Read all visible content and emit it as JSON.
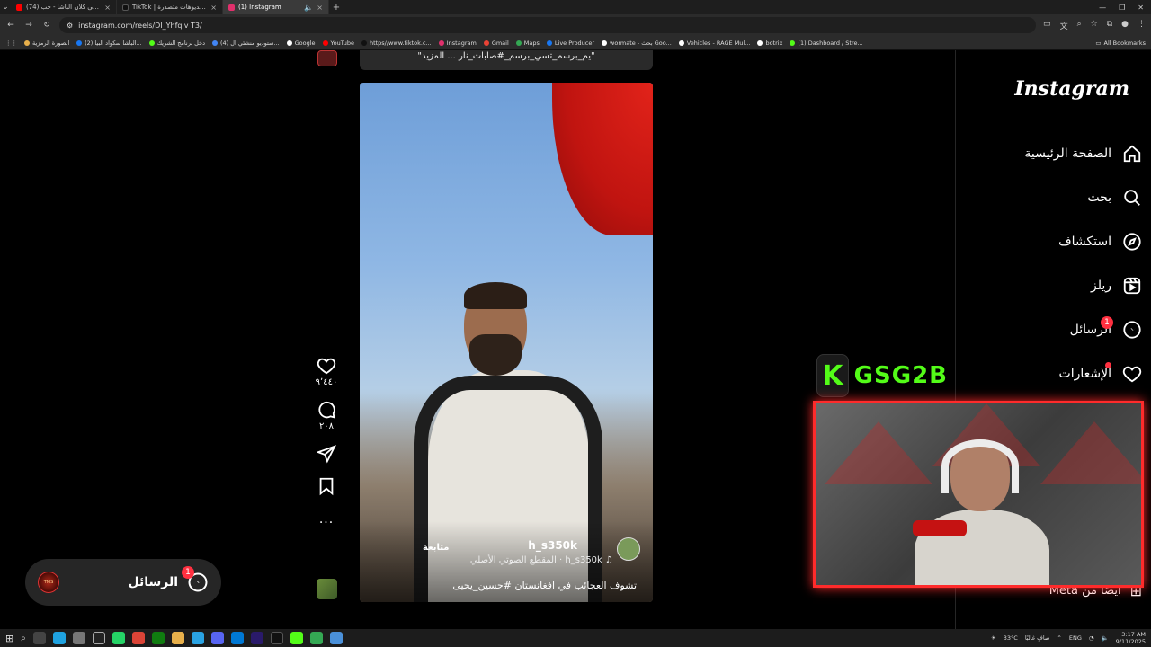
{
  "browser": {
    "tabs": [
      {
        "label": "(74) تقديم على كلان الباشا - جب",
        "active": false,
        "favicon_color": "#ff0000"
      },
      {
        "label": "TikTok | شاهد فيديوهات متصدرة",
        "active": false,
        "favicon_color": "#111111"
      },
      {
        "label": "(1) Instagram",
        "active": true,
        "favicon_color": "#e1306c"
      }
    ],
    "new_tab": "+",
    "url": "instagram.com/reels/DI_Yhfqiv T3/",
    "bookmarks": [
      {
        "label": "الصورة الرمزية",
        "color": "#e8b04b"
      },
      {
        "label": "(2) الباشا سكواد البيا...",
        "color": "#1877f2"
      },
      {
        "label": "دخل برنامج الشريك",
        "color": "#53fc18"
      },
      {
        "label": "(4) ستوديو منشئي ال...",
        "color": "#4285f4"
      },
      {
        "label": "Google",
        "color": "#ffffff"
      },
      {
        "label": "YouTube",
        "color": "#ff0000"
      },
      {
        "label": "https//www.tiktok.c...",
        "color": "#111111"
      },
      {
        "label": "Instagram",
        "color": "#e1306c"
      },
      {
        "label": "Gmail",
        "color": "#ea4335"
      },
      {
        "label": "Maps",
        "color": "#34a853"
      },
      {
        "label": "Live Producer",
        "color": "#1877f2"
      },
      {
        "label": "wormate - بحث Goo...",
        "color": "#ffffff"
      },
      {
        "label": "Vehicles - RAGE Mul...",
        "color": "#ffffff"
      },
      {
        "label": "botrix",
        "color": "#ffffff"
      },
      {
        "label": "(1) Dashboard / Stre...",
        "color": "#53fc18"
      }
    ],
    "all_bookmarks": "All Bookmarks"
  },
  "reel": {
    "prev_caption": "\"يم_برسم_تسي_برسم_#صابات_نار ... المزيد\"",
    "username": "h_s350k",
    "follow": "متابعة",
    "audio": "h_s350k · المقطع الصوتي الأصلي",
    "caption": "تشوف العجائب في افغانستان #حسين_يحيى",
    "mute_icon": "speaker-icon"
  },
  "actions": {
    "likes": "٩٬٤٤٠",
    "comments": "٢٠٨",
    "more": "..."
  },
  "messages_pill": {
    "label": "الرسائل",
    "badge": "1",
    "avatar_text": "TMS"
  },
  "sidebar": {
    "logo": "Instagram",
    "items": [
      {
        "label": "الصفحة الرئيسية",
        "icon": "home-icon"
      },
      {
        "label": "بحث",
        "icon": "search-icon"
      },
      {
        "label": "استكشاف",
        "icon": "compass-icon"
      },
      {
        "label": "ريلز",
        "icon": "reels-icon"
      },
      {
        "label": "الرسائل",
        "icon": "messenger-icon",
        "badge": "1"
      },
      {
        "label": "الإشعارات",
        "icon": "heart-icon"
      }
    ],
    "also_from_meta": "أيضًا من Meta"
  },
  "stream": {
    "kick_letter": "K",
    "channel_name": "GSG2B",
    "accent": "#53fc18",
    "frame_color": "#ff2b2b"
  },
  "taskbar": {
    "weather": "33°C",
    "weather_label": "صافٍ غالبًا",
    "lang": "ENG",
    "time": "3:17 AM",
    "date": "9/11/2025"
  }
}
